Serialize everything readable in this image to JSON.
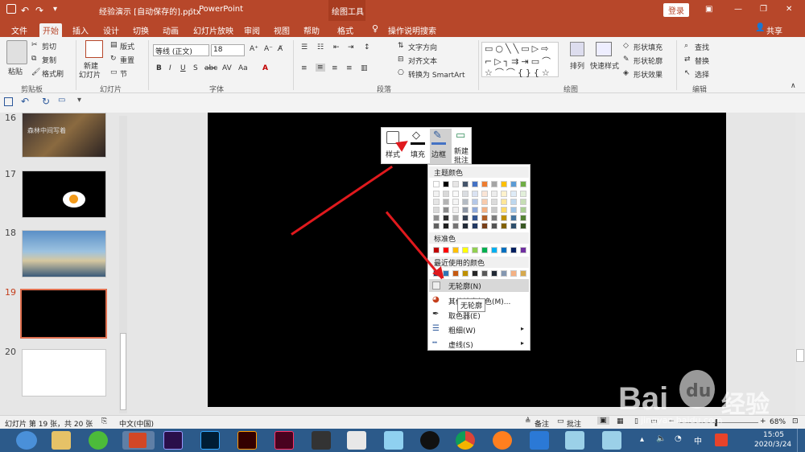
{
  "title": {
    "file": "经验演示 [自动保存的].pptx",
    "sep": "-",
    "app": "PowerPoint",
    "context": "绘图工具",
    "login": "登录"
  },
  "tabs": [
    "文件",
    "开始",
    "插入",
    "设计",
    "切换",
    "动画",
    "幻灯片放映",
    "审阅",
    "视图",
    "帮助",
    "格式"
  ],
  "tell_me": "操作说明搜索",
  "share": "共享",
  "clipboard": {
    "paste": "粘贴",
    "cut": "剪切",
    "copy": "复制",
    "painter": "格式刷",
    "label": "剪贴板"
  },
  "slides": {
    "new1": "新建",
    "new2": "幻灯片",
    "layout": "版式",
    "reset": "重置",
    "section": "节",
    "label": "幻灯片"
  },
  "font": {
    "name": "等线 (正文)",
    "size": "18",
    "label": "字体"
  },
  "para": {
    "dir": "文字方向",
    "align": "对齐文本",
    "smart": "转换为 SmartArt",
    "label": "段落"
  },
  "drawing": {
    "arrange": "排列",
    "quick": "快速样式",
    "fill": "形状填充",
    "outline": "形状轮廓",
    "effect": "形状效果",
    "label": "绘图"
  },
  "editing": {
    "find": "查找",
    "replace": "替换",
    "select": "选择",
    "label": "编辑"
  },
  "thumbs": [
    {
      "n": "16"
    },
    {
      "n": "17"
    },
    {
      "n": "18"
    },
    {
      "n": "19"
    },
    {
      "n": "20"
    }
  ],
  "thumb16_text": "森林中间写着",
  "mini": {
    "style": "样式",
    "fill": "填充",
    "border": "边框",
    "newcomment1": "新建",
    "newcomment2": "批注"
  },
  "menu": {
    "theme": "主题颜色",
    "standard": "标准色",
    "recent": "最近使用的颜色",
    "no_outline": "无轮廓(N)",
    "more": "其他轮廓颜色(M)...",
    "eyedropper": "取色器(E)",
    "weight": "粗细(W)",
    "dashes": "虚线(S)",
    "tooltip": "无轮廓"
  },
  "colors": {
    "theme_top": [
      "#ffffff",
      "#000000",
      "#e7e6e6",
      "#44546a",
      "#4472c4",
      "#ed7d31",
      "#a5a5a5",
      "#ffc000",
      "#5b9bd5",
      "#70ad47"
    ],
    "standard": [
      "#c00000",
      "#ff0000",
      "#ffc000",
      "#ffff00",
      "#92d050",
      "#00b050",
      "#00b0f0",
      "#0070c0",
      "#002060",
      "#7030a0"
    ],
    "recent": [
      "#1f3864",
      "#2e75b6",
      "#c55a11",
      "#bf9000",
      "#262626",
      "#595959",
      "#222a35",
      "#8497b0",
      "#f4b183",
      "#d6a94f"
    ]
  },
  "status": {
    "slide": "幻灯片 第 19 张，共 20 张",
    "lang": "中文(中国)",
    "notes": "备注",
    "comments": "批注",
    "zoom": "68%"
  },
  "clock": {
    "time": "15:05",
    "date": "2020/3/24"
  },
  "watermark": {
    "brand": "Bai",
    "tag": "经验",
    "url": "jingyan.baidu.com"
  },
  "accent": "#b7472a"
}
